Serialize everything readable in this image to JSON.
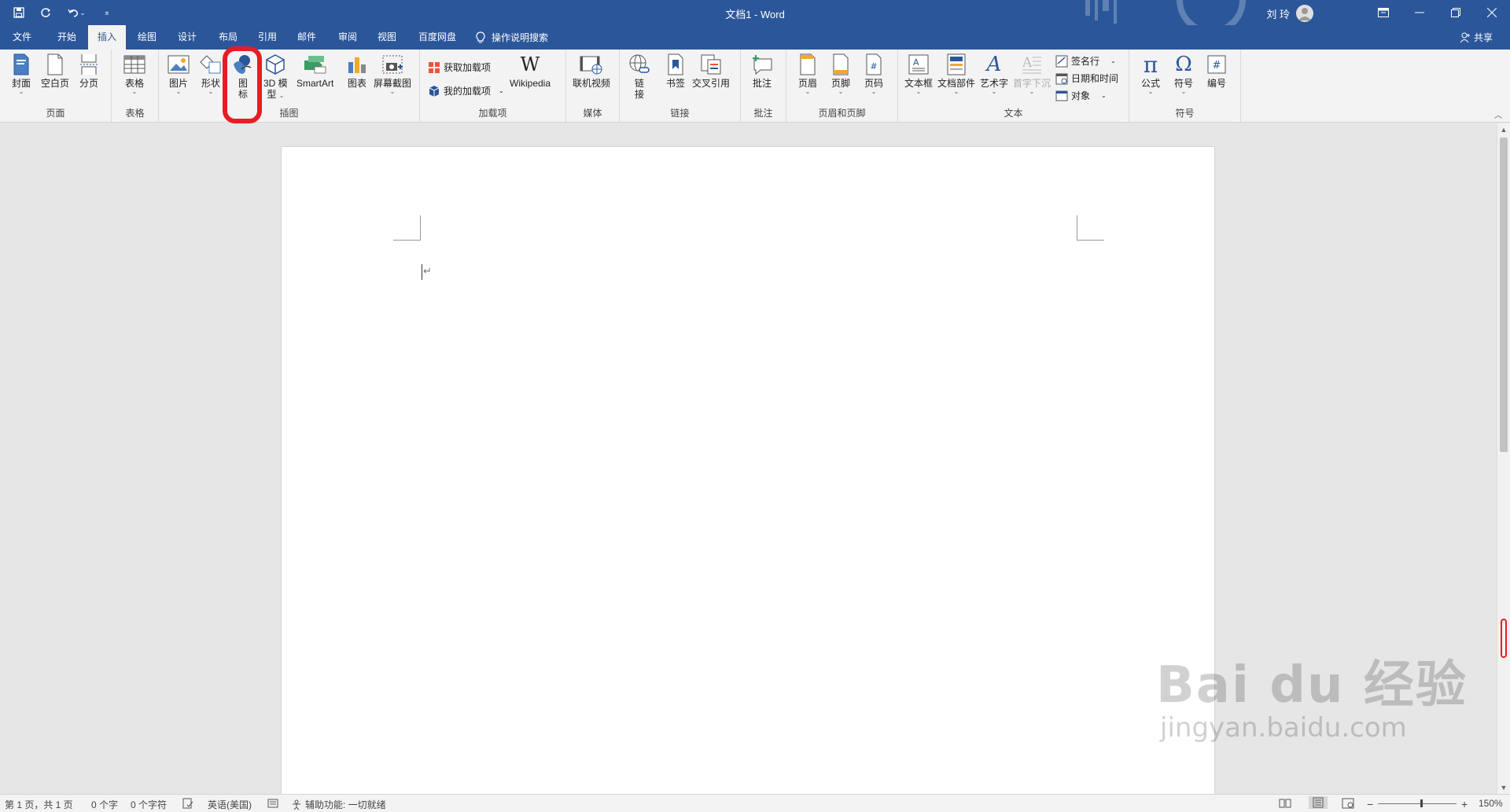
{
  "titlebar": {
    "title": "文档1  -  Word",
    "user": "刘 玲",
    "qat": [
      "save-icon",
      "autosave-icon",
      "undo-icon",
      "customize-icon"
    ]
  },
  "tabs": [
    {
      "label": "文件"
    },
    {
      "label": "开始"
    },
    {
      "label": "插入"
    },
    {
      "label": "绘图"
    },
    {
      "label": "设计"
    },
    {
      "label": "布局"
    },
    {
      "label": "引用"
    },
    {
      "label": "邮件"
    },
    {
      "label": "审阅"
    },
    {
      "label": "视图"
    },
    {
      "label": "百度网盘"
    }
  ],
  "tell_me": "操作说明搜索",
  "share": "共享",
  "ribbon": {
    "pages": {
      "label": "页面",
      "cover": "封面",
      "blank": "空白页",
      "break": "分页"
    },
    "tables": {
      "label": "表格",
      "table": "表格"
    },
    "illustrations": {
      "label": "插图",
      "pictures": "图片",
      "shapes": "形状",
      "icons_1": "图",
      "icons_2": "标",
      "model_1": "3D 模",
      "model_2": "型",
      "smartart": "SmartArt",
      "chart": "图表",
      "screenshot": "屏幕截图"
    },
    "addins": {
      "label": "加载项",
      "get": "获取加载项",
      "my": "我的加载项",
      "wikipedia": "Wikipedia"
    },
    "media": {
      "label": "媒体",
      "video": "联机视频"
    },
    "links": {
      "label": "链接",
      "link_1": "链",
      "link_2": "接",
      "bookmark": "书签",
      "cross_ref": "交叉引用"
    },
    "comments": {
      "label": "批注",
      "comment": "批注"
    },
    "header_footer": {
      "label": "页眉和页脚",
      "header": "页眉",
      "footer": "页脚",
      "page_number": "页码"
    },
    "text": {
      "label": "文本",
      "textbox": "文本框",
      "quick_parts": "文档部件",
      "wordart": "艺术字",
      "dropcap": "首字下沉",
      "signature": "签名行",
      "datetime": "日期和时间",
      "object": "对象"
    },
    "symbols": {
      "label": "符号",
      "equation": "公式",
      "symbol": "符号",
      "number": "编号"
    }
  },
  "status": {
    "page": "第 1 页，共 1 页",
    "words": "0 个字",
    "chars": "0 个字符",
    "language": "英语(美国)",
    "accessibility": "辅助功能: 一切就绪",
    "zoom": "150%"
  },
  "watermark": {
    "main": "Bai du 经验",
    "sub": "jingyan.baidu.com"
  },
  "colors": {
    "brand": "#2b579a",
    "annotation": "#e81c23"
  }
}
